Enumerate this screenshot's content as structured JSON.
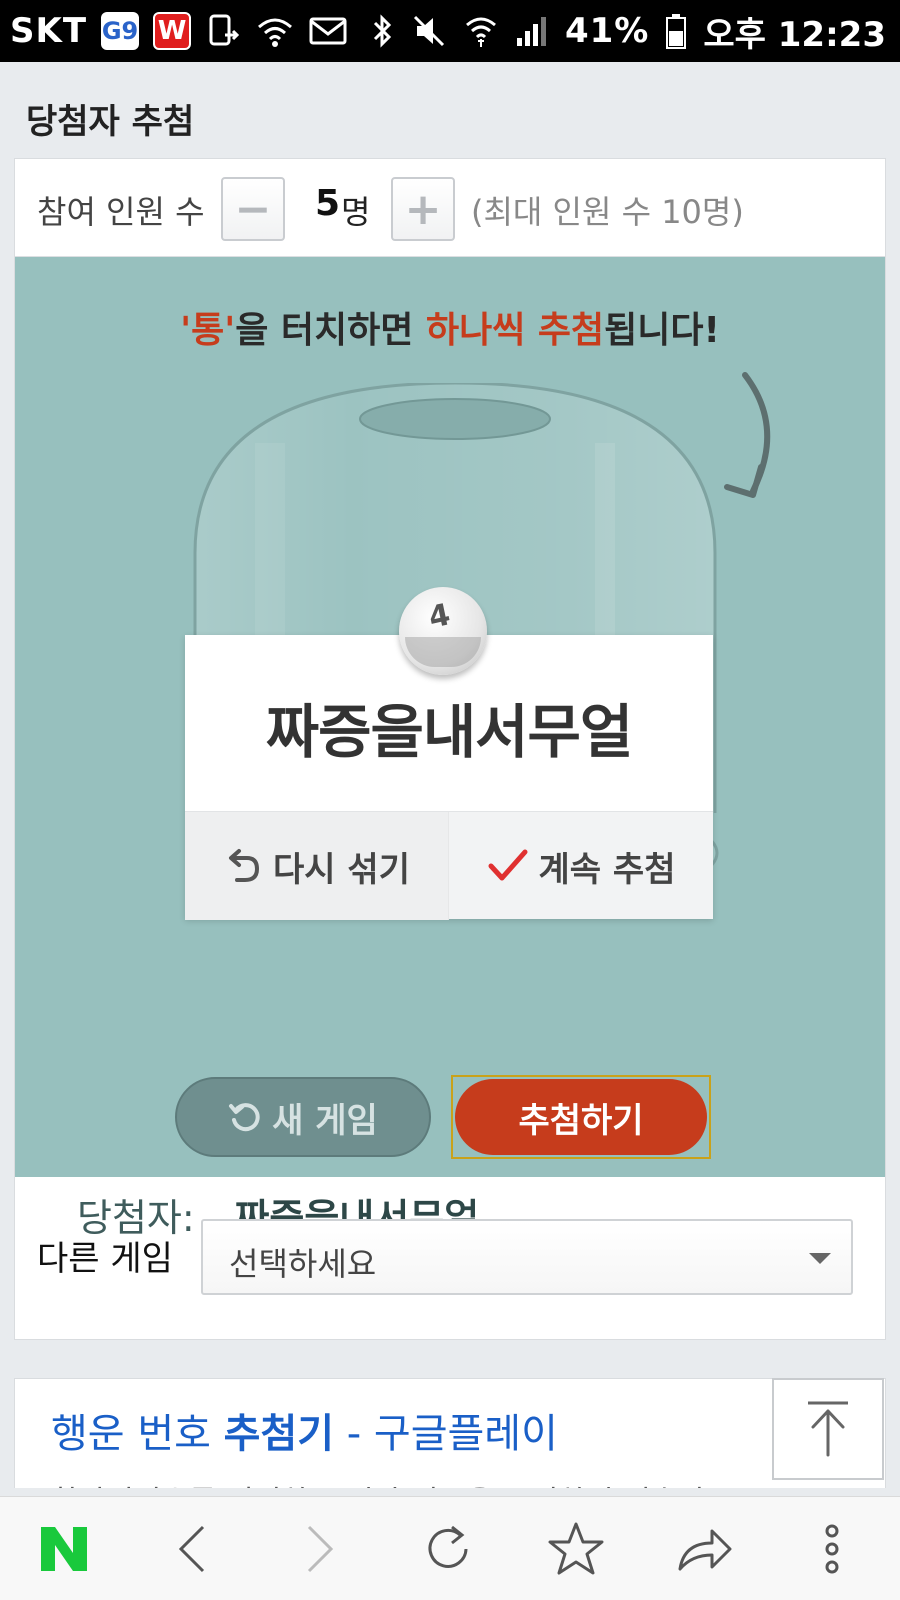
{
  "status_bar": {
    "carrier": "SKT",
    "app_badge_1": "G9",
    "app_badge_2": "W",
    "battery": "41%",
    "time": "오후 12:23"
  },
  "page_title": "당첨자 추첨",
  "participants": {
    "label": "참여 인원 수",
    "minus": "−",
    "plus": "+",
    "value": "5",
    "unit": "명",
    "max_note": "(최대 인원 수 10명)"
  },
  "instruction": {
    "part1": "'통'",
    "part2": "을 터치하면 ",
    "part3": "하나씩 추첨",
    "part4": "됩니다!"
  },
  "ball_number": "4",
  "popup": {
    "name": "짜증을내서무얼",
    "reshuffle_label": "다시 섞기",
    "continue_label": "계속 추첨"
  },
  "buttons": {
    "new_game": "새 게임",
    "draw": "추첨하기"
  },
  "winners": {
    "label": "당첨자: ",
    "value": ", 짜증을내서무얼"
  },
  "other_game": {
    "label": "다른 게임",
    "select_value": "선택하세요"
  },
  "result": {
    "title_part1": "행운 번호 ",
    "title_part2": "추첨기",
    "title_part3": " - 구글플레이",
    "snippet": "참가인원수를 입력하고 시작 버튼을 클릭하면 번호가"
  },
  "colors": {
    "accent_red": "#c63c1c",
    "stage_bg": "#97c0be",
    "link_blue": "#1a5fc7",
    "naver_green": "#19c93c"
  },
  "icons": {
    "bottom_nav": [
      "naver-icon",
      "back-icon",
      "forward-icon",
      "refresh-icon",
      "bookmark-star-icon",
      "share-icon",
      "more-icon"
    ]
  }
}
